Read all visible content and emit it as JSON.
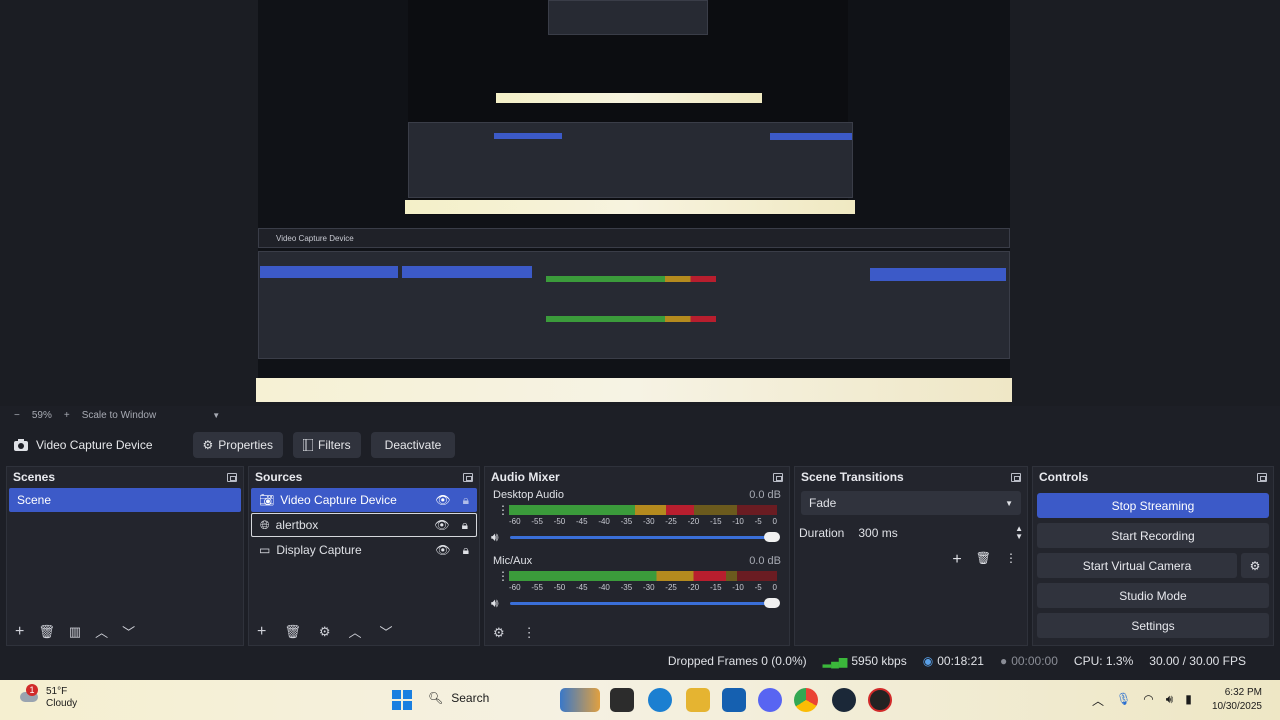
{
  "preview": {
    "zoom_label": "59%",
    "scale_label": "Scale to Window"
  },
  "source_toolbar": {
    "source_name": "Video Capture Device",
    "properties": "Properties",
    "filters": "Filters",
    "deactivate": "Deactivate"
  },
  "scenes": {
    "title": "Scenes",
    "items": [
      "Scene"
    ]
  },
  "sources": {
    "title": "Sources",
    "items": [
      {
        "label": "Video Capture Device",
        "icon": "camera-icon"
      },
      {
        "label": "alertbox",
        "icon": "globe-icon"
      },
      {
        "label": "Display Capture",
        "icon": "monitor-icon"
      }
    ]
  },
  "mixer": {
    "title": "Audio Mixer",
    "channels": [
      {
        "name": "Desktop Audio",
        "db": "0.0 dB",
        "level": 0.69,
        "volume": 1.0
      },
      {
        "name": "Mic/Aux",
        "db": "0.0 dB",
        "level": 0.81,
        "volume": 1.0
      }
    ],
    "ticks": [
      "-60",
      "-55",
      "-50",
      "-45",
      "-40",
      "-35",
      "-30",
      "-25",
      "-20",
      "-15",
      "-10",
      "-5",
      "0"
    ]
  },
  "transitions": {
    "title": "Scene Transitions",
    "selected": "Fade",
    "duration_label": "Duration",
    "duration_value": "300 ms"
  },
  "controls": {
    "title": "Controls",
    "stop_streaming": "Stop Streaming",
    "start_recording": "Start Recording",
    "start_virtual_camera": "Start Virtual Camera",
    "studio_mode": "Studio Mode",
    "settings": "Settings"
  },
  "status": {
    "dropped_frames": "Dropped Frames 0 (0.0%)",
    "bitrate": "5950 kbps",
    "stream_time": "00:18:21",
    "record_time": "00:00:00",
    "cpu": "CPU: 1.3%",
    "fps": "30.00 / 30.00 FPS"
  },
  "taskbar": {
    "weather_temp": "51°F",
    "weather_desc": "Cloudy",
    "notification_badge": "1",
    "search": "Search",
    "time": "6:32 PM",
    "date": "10/30/2025"
  },
  "colors": {
    "accent": "#3c5ac8",
    "panel": "#23252d",
    "meter_green": "#3b9b3b",
    "meter_yellow": "#b48a1e",
    "meter_red": "#b81e2e"
  }
}
